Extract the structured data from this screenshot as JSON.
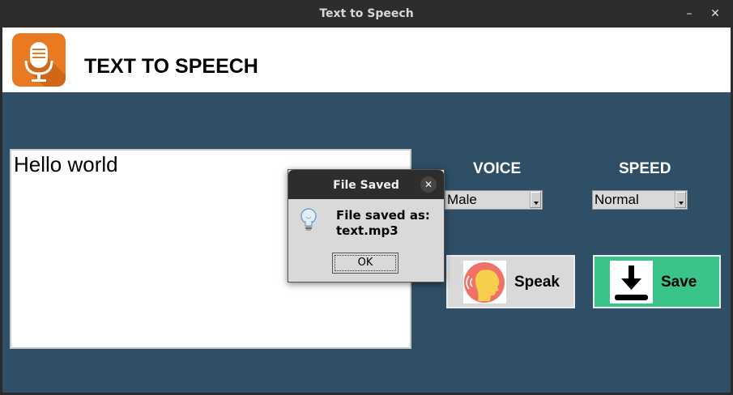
{
  "window": {
    "title": "Text to Speech",
    "minimize_glyph": "–",
    "close_glyph": "✕"
  },
  "header": {
    "app_title": "TEXT TO SPEECH",
    "logo_icon": "microphone-icon",
    "logo_color": "#ea7a22"
  },
  "editor": {
    "text": "Hello world"
  },
  "voice": {
    "label": "VOICE",
    "selected": "Male"
  },
  "speed": {
    "label": "SPEED",
    "selected": "Normal"
  },
  "buttons": {
    "speak": {
      "label": "Speak",
      "icon": "speaking-head-icon"
    },
    "save": {
      "label": "Save",
      "icon": "download-icon",
      "color": "#3ac48a"
    }
  },
  "dialog": {
    "title": "File Saved",
    "message_line1": "File saved as:",
    "message_line2": "text.mp3",
    "ok_label": "OK",
    "icon": "lightbulb-icon",
    "close_glyph": "✕"
  },
  "colors": {
    "background": "#2f4f66",
    "titlebar": "#2d2d2d"
  }
}
